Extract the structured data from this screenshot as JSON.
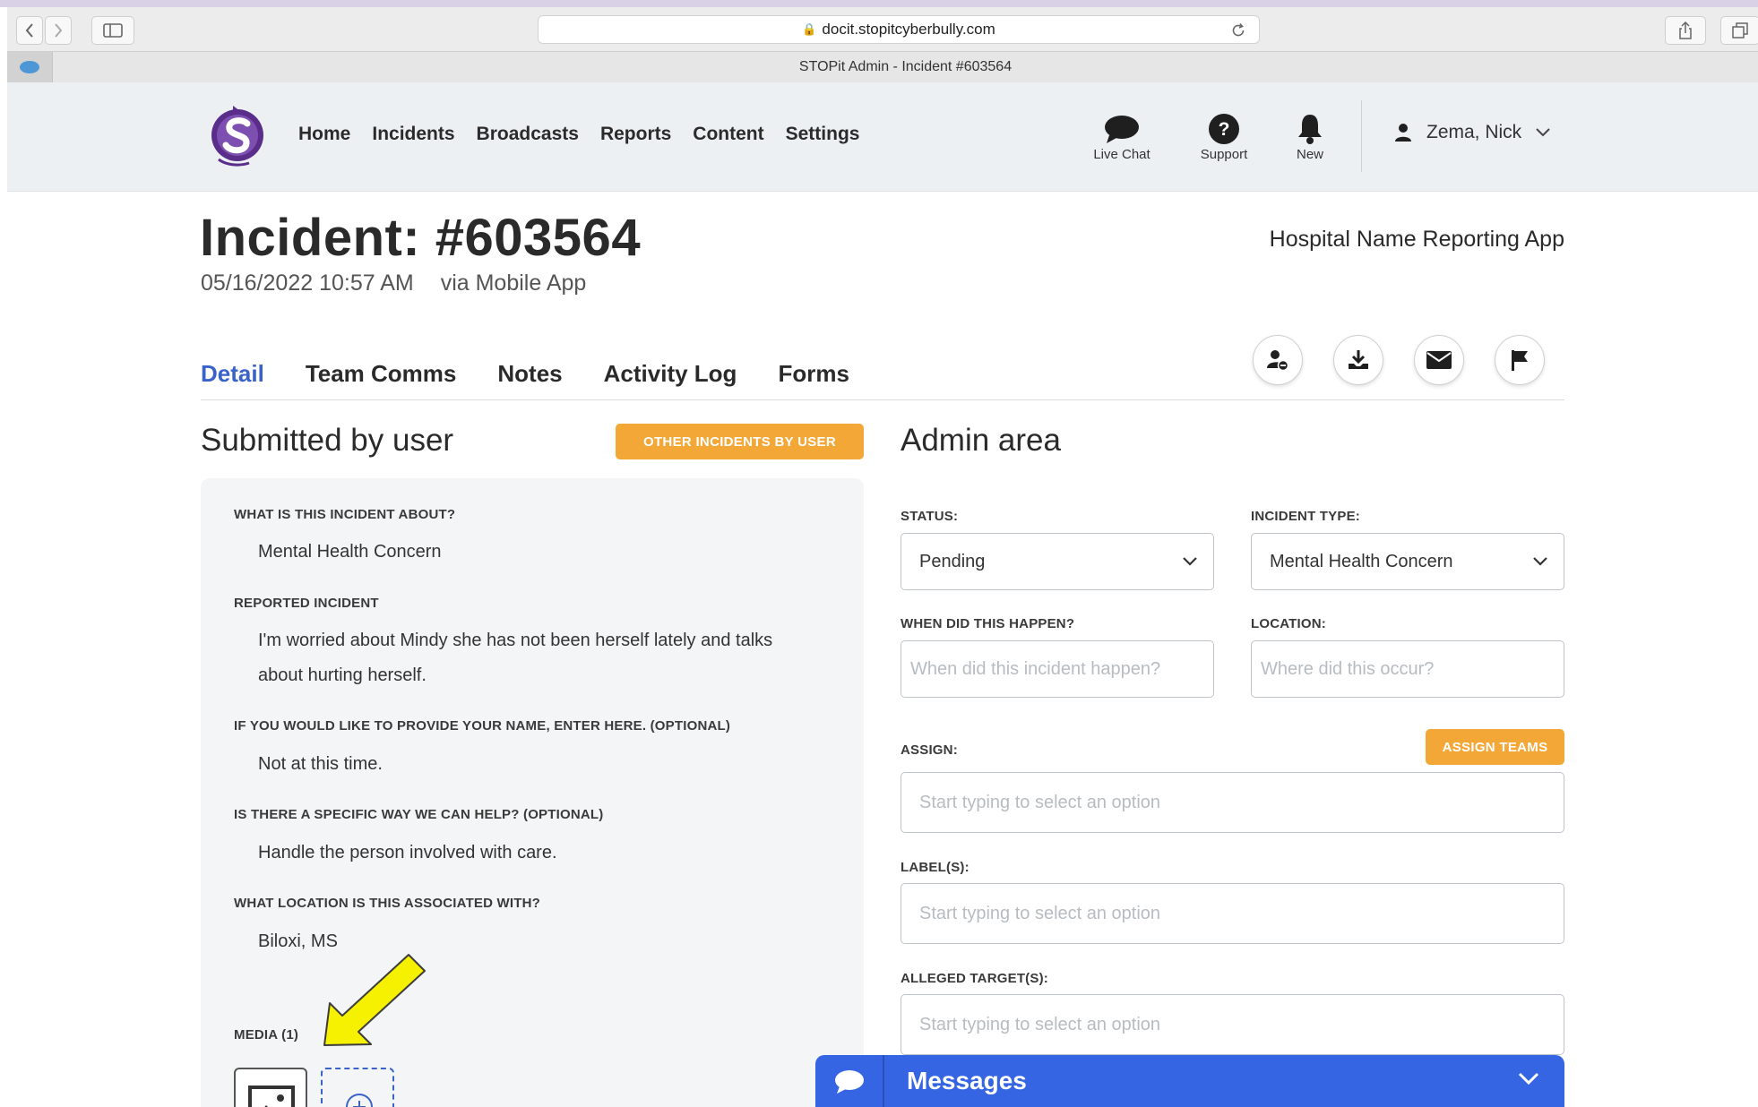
{
  "browser": {
    "url": "docit.stopitcyberbully.com",
    "tab_title": "STOPit Admin - Incident #603564"
  },
  "header": {
    "nav": [
      "Home",
      "Incidents",
      "Broadcasts",
      "Reports",
      "Content",
      "Settings"
    ],
    "icons": [
      {
        "label": "Live Chat",
        "icon": "chat-bubble-icon"
      },
      {
        "label": "Support",
        "icon": "question-icon"
      },
      {
        "label": "New",
        "icon": "bell-icon"
      }
    ],
    "user_name": "Zema, Nick"
  },
  "incident": {
    "title": "Incident: #603564",
    "datetime": "05/16/2022 10:57 AM",
    "via": "via Mobile App",
    "org": "Hospital Name Reporting App"
  },
  "tabs": [
    {
      "label": "Detail",
      "active": true
    },
    {
      "label": "Team Comms",
      "active": false
    },
    {
      "label": "Notes",
      "active": false
    },
    {
      "label": "Activity Log",
      "active": false
    },
    {
      "label": "Forms",
      "active": false
    }
  ],
  "action_icons": [
    "assign-user-icon",
    "download-icon",
    "email-icon",
    "flag-icon"
  ],
  "submitted": {
    "title": "Submitted by user",
    "other_btn": "OTHER INCIDENTS BY USER",
    "qa": [
      {
        "q": "WHAT IS THIS INCIDENT ABOUT?",
        "a": "Mental Health Concern"
      },
      {
        "q": "REPORTED INCIDENT",
        "a": "I'm worried about Mindy she has not been herself lately and talks about hurting herself."
      },
      {
        "q": "IF YOU WOULD LIKE TO PROVIDE YOUR NAME, ENTER HERE. (OPTIONAL)",
        "a": "Not at this time."
      },
      {
        "q": "IS THERE A SPECIFIC WAY WE CAN HELP? (OPTIONAL)",
        "a": "Handle the person involved with care."
      },
      {
        "q": "WHAT LOCATION IS THIS ASSOCIATED WITH?",
        "a": "Biloxi, MS"
      }
    ],
    "media_label": "MEDIA (1)"
  },
  "admin": {
    "title": "Admin area",
    "status_label": "STATUS:",
    "status_value": "Pending",
    "type_label": "INCIDENT TYPE:",
    "type_value": "Mental Health Concern",
    "when_label": "WHEN DID THIS HAPPEN?",
    "when_placeholder": "When did this incident happen?",
    "location_label": "LOCATION:",
    "location_placeholder": "Where did this occur?",
    "assign_label": "ASSIGN:",
    "assign_btn": "ASSIGN TEAMS",
    "assign_placeholder": "Start typing to select an option",
    "labels_label": "LABEL(S):",
    "labels_placeholder": "Start typing to select an option",
    "targets_label": "ALLEGED TARGET(S):",
    "targets_placeholder": "Start typing to select an option"
  },
  "messages": {
    "label": "Messages"
  },
  "colors": {
    "accent_blue": "#3a63c9",
    "orange": "#f3a736",
    "messages_bar": "#3565e3",
    "logo_purple": "#5b2d8a",
    "arrow_yellow": "#f5f100"
  }
}
